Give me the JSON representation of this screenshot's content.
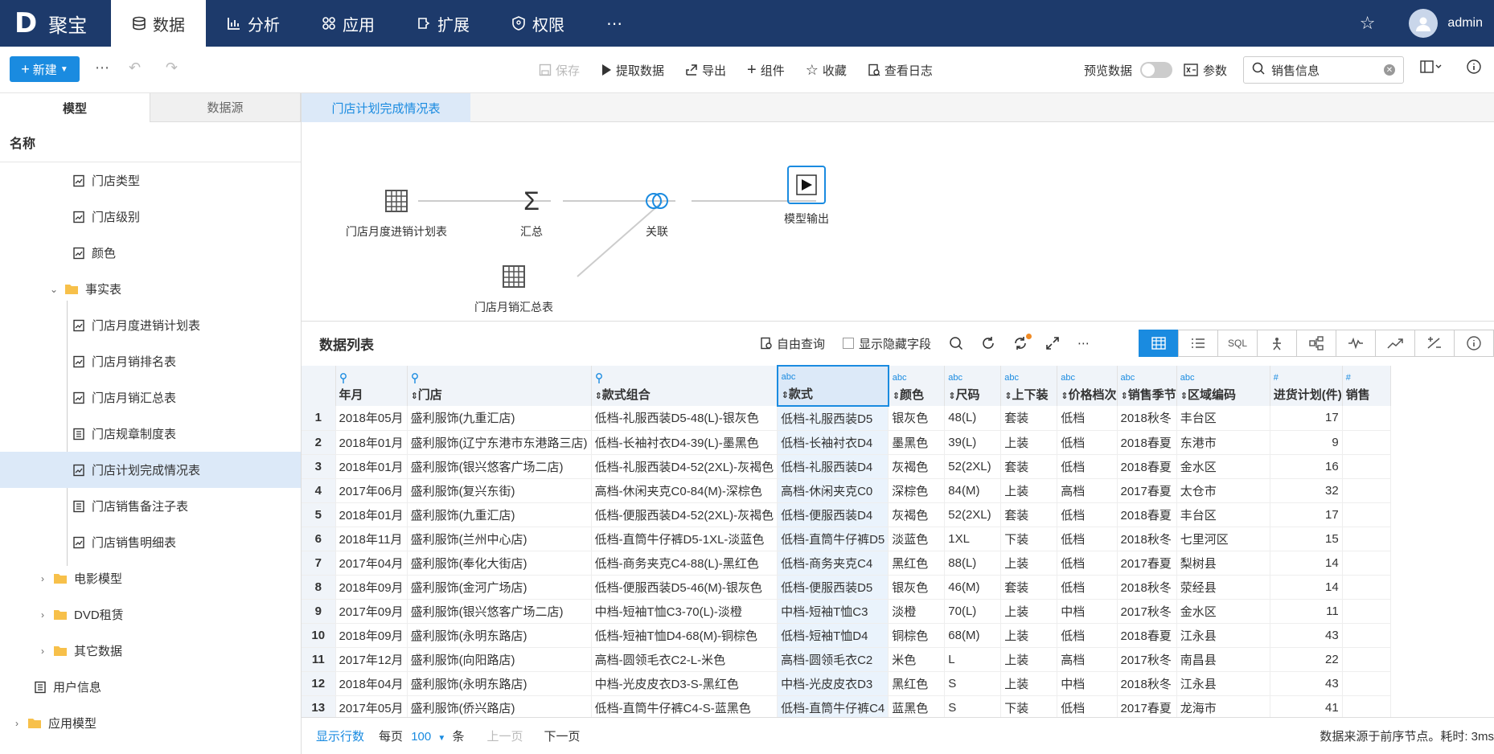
{
  "app": {
    "logo_mark": "D",
    "logo_text": "聚宝",
    "username": "admin"
  },
  "nav": [
    {
      "label": "数据",
      "icon": "database-icon",
      "active": true
    },
    {
      "label": "分析",
      "icon": "bar-chart-icon"
    },
    {
      "label": "应用",
      "icon": "apps-icon"
    },
    {
      "label": "扩展",
      "icon": "extension-icon"
    },
    {
      "label": "权限",
      "icon": "shield-icon"
    }
  ],
  "toolbar": {
    "new_label": "新建",
    "save_label": "保存",
    "extract_label": "提取数据",
    "export_label": "导出",
    "component_label": "组件",
    "favorite_label": "收藏",
    "log_label": "查看日志",
    "preview_label": "预览数据",
    "param_label": "参数",
    "search_value": "销售信息"
  },
  "left": {
    "tab_model": "模型",
    "tab_source": "数据源",
    "header": "名称",
    "items": [
      {
        "label": "门店类型",
        "type": "model"
      },
      {
        "label": "门店级别",
        "type": "model"
      },
      {
        "label": "颜色",
        "type": "model"
      },
      {
        "label": "事实表",
        "type": "folder"
      },
      {
        "label": "门店月度进销计划表",
        "type": "model"
      },
      {
        "label": "门店月销排名表",
        "type": "model"
      },
      {
        "label": "门店月销汇总表",
        "type": "model"
      },
      {
        "label": "门店规章制度表",
        "type": "table"
      },
      {
        "label": "门店计划完成情况表",
        "type": "model"
      },
      {
        "label": "门店销售备注子表",
        "type": "table"
      },
      {
        "label": "门店销售明细表",
        "type": "model"
      },
      {
        "label": "电影模型",
        "type": "folder"
      },
      {
        "label": "DVD租赁",
        "type": "folder"
      },
      {
        "label": "其它数据",
        "type": "folder"
      },
      {
        "label": "用户信息",
        "type": "table"
      },
      {
        "label": "应用模型",
        "type": "folder"
      }
    ]
  },
  "right": {
    "tab": "门店计划完成情况表",
    "nodes": {
      "plan": "门店月度进销计划表",
      "sum": "汇总",
      "join": "关联",
      "output": "模型输出",
      "monthly": "门店月销汇总表"
    },
    "list_title": "数据列表",
    "free_query": "自由查询",
    "show_hidden": "显示隐藏字段",
    "sql_label": "SQL"
  },
  "table": {
    "columns": [
      {
        "type": "",
        "label": "年月"
      },
      {
        "type": "",
        "label": "门店"
      },
      {
        "type": "",
        "label": "款式组合"
      },
      {
        "type": "abc",
        "label": "款式"
      },
      {
        "type": "abc",
        "label": "颜色"
      },
      {
        "type": "abc",
        "label": "尺码"
      },
      {
        "type": "abc",
        "label": "上下装"
      },
      {
        "type": "abc",
        "label": "价格档次"
      },
      {
        "type": "abc",
        "label": "销售季节"
      },
      {
        "type": "abc",
        "label": "区域编码"
      },
      {
        "type": "#",
        "label": "进货计划(件)"
      },
      {
        "type": "#",
        "label": "销售"
      }
    ],
    "rows": [
      [
        "1",
        "2018年05月",
        "盛利服饰(九重汇店)",
        "低档-礼服西装D5-48(L)-银灰色",
        "低档-礼服西装D5",
        "银灰色",
        "48(L)",
        "套装",
        "低档",
        "2018秋冬",
        "丰台区",
        "17"
      ],
      [
        "2",
        "2018年01月",
        "盛利服饰(辽宁东港市东港路三店)",
        "低档-长袖衬衣D4-39(L)-墨黑色",
        "低档-长袖衬衣D4",
        "墨黑色",
        "39(L)",
        "上装",
        "低档",
        "2018春夏",
        "东港市",
        "9"
      ],
      [
        "3",
        "2018年01月",
        "盛利服饰(银兴悠客广场二店)",
        "低档-礼服西装D4-52(2XL)-灰褐色",
        "低档-礼服西装D4",
        "灰褐色",
        "52(2XL)",
        "套装",
        "低档",
        "2018春夏",
        "金水区",
        "16"
      ],
      [
        "4",
        "2017年06月",
        "盛利服饰(复兴东街)",
        "高档-休闲夹克C0-84(M)-深棕色",
        "高档-休闲夹克C0",
        "深棕色",
        "84(M)",
        "上装",
        "高档",
        "2017春夏",
        "太仓市",
        "32"
      ],
      [
        "5",
        "2018年01月",
        "盛利服饰(九重汇店)",
        "低档-便服西装D4-52(2XL)-灰褐色",
        "低档-便服西装D4",
        "灰褐色",
        "52(2XL)",
        "套装",
        "低档",
        "2018春夏",
        "丰台区",
        "17"
      ],
      [
        "6",
        "2018年11月",
        "盛利服饰(兰州中心店)",
        "低档-直筒牛仔裤D5-1XL-淡蓝色",
        "低档-直筒牛仔裤D5",
        "淡蓝色",
        "1XL",
        "下装",
        "低档",
        "2018秋冬",
        "七里河区",
        "15"
      ],
      [
        "7",
        "2017年04月",
        "盛利服饰(奉化大街店)",
        "低档-商务夹克C4-88(L)-黑红色",
        "低档-商务夹克C4",
        "黑红色",
        "88(L)",
        "上装",
        "低档",
        "2017春夏",
        "梨树县",
        "14"
      ],
      [
        "8",
        "2018年09月",
        "盛利服饰(金河广场店)",
        "低档-便服西装D5-46(M)-银灰色",
        "低档-便服西装D5",
        "银灰色",
        "46(M)",
        "套装",
        "低档",
        "2018秋冬",
        "荥经县",
        "14"
      ],
      [
        "9",
        "2017年09月",
        "盛利服饰(银兴悠客广场二店)",
        "中档-短袖T恤C3-70(L)-淡橙",
        "中档-短袖T恤C3",
        "淡橙",
        "70(L)",
        "上装",
        "中档",
        "2017秋冬",
        "金水区",
        "11"
      ],
      [
        "10",
        "2018年09月",
        "盛利服饰(永明东路店)",
        "低档-短袖T恤D4-68(M)-铜棕色",
        "低档-短袖T恤D4",
        "铜棕色",
        "68(M)",
        "上装",
        "低档",
        "2018春夏",
        "江永县",
        "43"
      ],
      [
        "11",
        "2017年12月",
        "盛利服饰(向阳路店)",
        "高档-圆领毛衣C2-L-米色",
        "高档-圆领毛衣C2",
        "米色",
        "L",
        "上装",
        "高档",
        "2017秋冬",
        "南昌县",
        "22"
      ],
      [
        "12",
        "2018年04月",
        "盛利服饰(永明东路店)",
        "中档-光皮皮衣D3-S-黑红色",
        "中档-光皮皮衣D3",
        "黑红色",
        "S",
        "上装",
        "中档",
        "2018秋冬",
        "江永县",
        "43"
      ],
      [
        "13",
        "2017年05月",
        "盛利服饰(侨兴路店)",
        "低档-直筒牛仔裤C4-S-蓝黑色",
        "低档-直筒牛仔裤C4",
        "蓝黑色",
        "S",
        "下装",
        "低档",
        "2017春夏",
        "龙海市",
        "41"
      ]
    ]
  },
  "footer": {
    "show_rows": "显示行数",
    "per_page": "每页",
    "per_page_value": "100",
    "unit": "条",
    "prev": "上一页",
    "next": "下一页",
    "status": "数据来源于前序节点。耗时: 3ms"
  }
}
